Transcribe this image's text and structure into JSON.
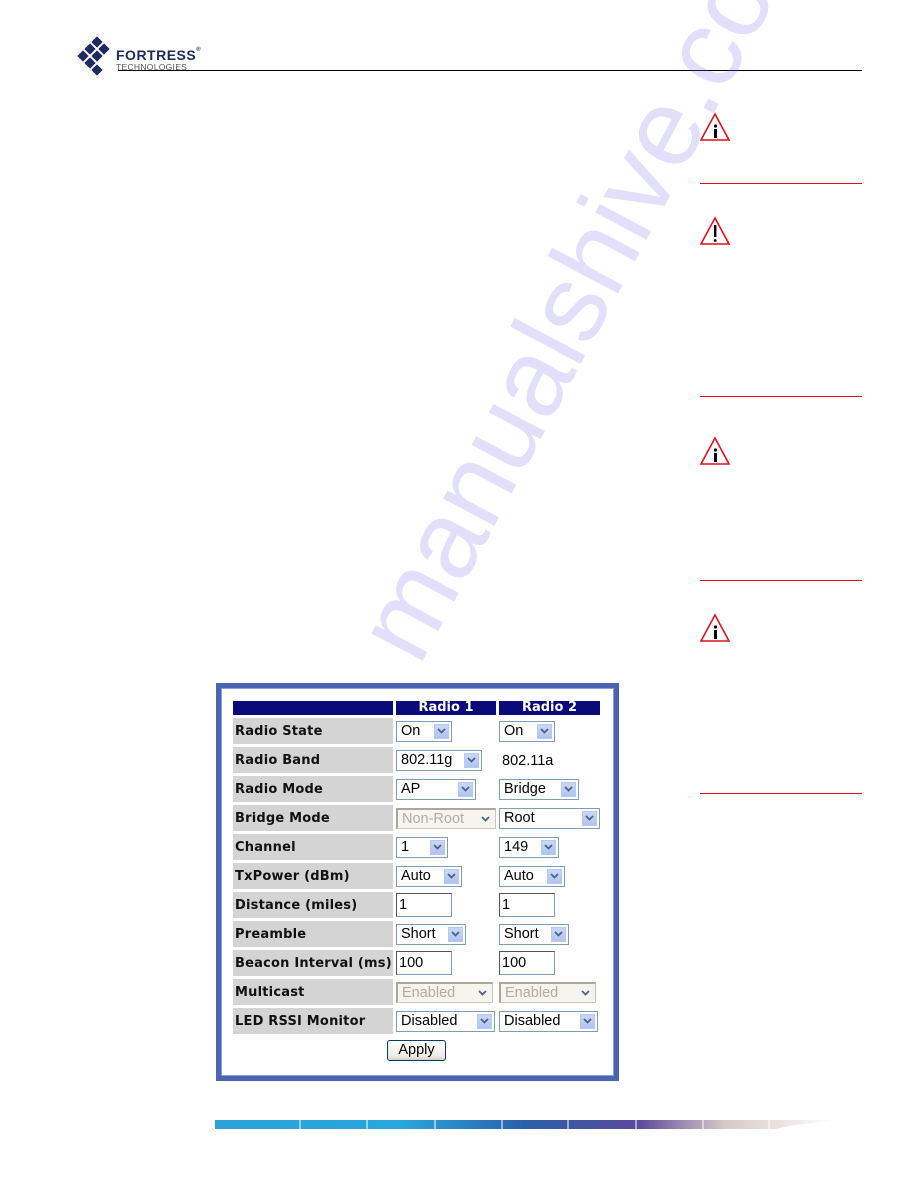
{
  "header": {
    "brand_name": "FORTRESS",
    "brand_reg": "®",
    "brand_sub": "TECHNOLOGIES"
  },
  "margin_notes": [
    {
      "icon": "info-warning-icon"
    },
    {
      "icon": "caution-exclamation-icon"
    },
    {
      "icon": "info-warning-icon"
    },
    {
      "icon": "info-warning-icon"
    }
  ],
  "watermark": "manualshive.com",
  "radio_settings": {
    "columns": [
      "",
      "Radio 1",
      "Radio 2"
    ],
    "rows": [
      {
        "label": "Radio State",
        "radio1": {
          "type": "select",
          "value": "On"
        },
        "radio2": {
          "type": "select",
          "value": "On"
        }
      },
      {
        "label": "Radio Band",
        "radio1": {
          "type": "select",
          "value": "802.11g"
        },
        "radio2": {
          "type": "static",
          "value": "802.11a"
        }
      },
      {
        "label": "Radio Mode",
        "radio1": {
          "type": "select",
          "value": "AP"
        },
        "radio2": {
          "type": "select",
          "value": "Bridge"
        }
      },
      {
        "label": "Bridge Mode",
        "radio1": {
          "type": "select",
          "value": "Non-Root",
          "disabled": true
        },
        "radio2": {
          "type": "select",
          "value": "Root"
        }
      },
      {
        "label": "Channel",
        "radio1": {
          "type": "select",
          "value": "1"
        },
        "radio2": {
          "type": "select",
          "value": "149"
        }
      },
      {
        "label": "TxPower (dBm)",
        "radio1": {
          "type": "select",
          "value": "Auto"
        },
        "radio2": {
          "type": "select",
          "value": "Auto"
        }
      },
      {
        "label": "Distance (miles)",
        "radio1": {
          "type": "text",
          "value": "1"
        },
        "radio2": {
          "type": "text",
          "value": "1"
        }
      },
      {
        "label": "Preamble",
        "radio1": {
          "type": "select",
          "value": "Short"
        },
        "radio2": {
          "type": "select",
          "value": "Short"
        }
      },
      {
        "label": "Beacon Interval (ms)",
        "radio1": {
          "type": "text",
          "value": "100"
        },
        "radio2": {
          "type": "text",
          "value": "100"
        }
      },
      {
        "label": "Multicast",
        "radio1": {
          "type": "select",
          "value": "Enabled",
          "disabled": true
        },
        "radio2": {
          "type": "select",
          "value": "Enabled",
          "disabled": true
        }
      },
      {
        "label": "LED RSSI Monitor",
        "radio1": {
          "type": "select",
          "value": "Disabled"
        },
        "radio2": {
          "type": "select",
          "value": "Disabled"
        }
      }
    ],
    "apply_label": "Apply"
  },
  "colors": {
    "header_bg": "#0a0a78",
    "panel_border": "#4a63b3",
    "note_rule": "#d9141e",
    "label_bg": "#d4d4d4"
  }
}
